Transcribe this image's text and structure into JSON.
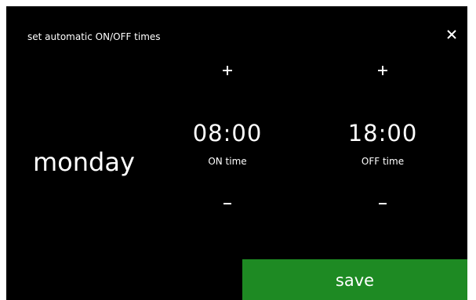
{
  "header": {
    "title": "set automatic ON/OFF times",
    "close_icon": "close-icon"
  },
  "schedule": {
    "day": "monday",
    "on": {
      "time": "08:00",
      "label": "ON time",
      "increase_icon": "plus-icon",
      "decrease_icon": "minus-icon"
    },
    "off": {
      "time": "18:00",
      "label": "OFF time",
      "increase_icon": "plus-icon",
      "decrease_icon": "minus-icon"
    }
  },
  "footer": {
    "save_label": "save"
  },
  "colors": {
    "background": "#000000",
    "text": "#ffffff",
    "save_button": "#1e8a23"
  }
}
